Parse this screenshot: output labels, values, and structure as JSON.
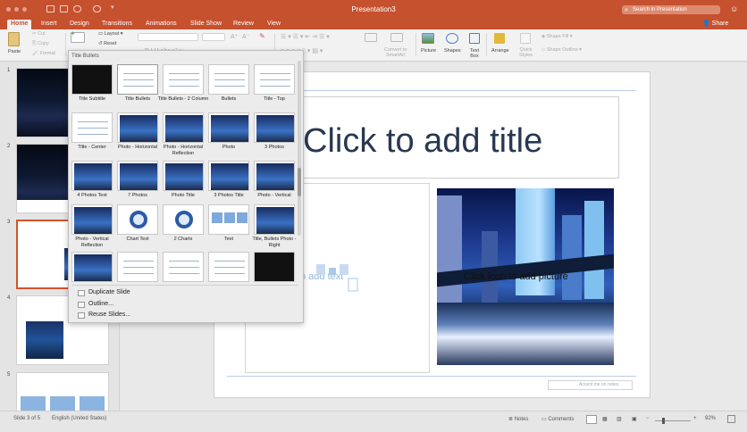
{
  "window": {
    "title": "Presentation3"
  },
  "search": {
    "placeholder": "Search in Presentation"
  },
  "share_label": "Share",
  "tabs": [
    "Home",
    "Insert",
    "Design",
    "Transitions",
    "Animations",
    "Slide Show",
    "Review",
    "View"
  ],
  "ribbon": {
    "paste": "Paste",
    "cut": "Cut",
    "copy": "Copy",
    "format": "Format",
    "layout": "Layout",
    "reset": "Reset",
    "convert_smartart": [
      "Convert to",
      "SmartArt"
    ],
    "picture": "Picture",
    "shapes": "Shapes",
    "text_box": [
      "Text",
      "Box"
    ],
    "arrange": "Arrange",
    "quick_styles": [
      "Quick",
      "Styles"
    ],
    "shape_fill": "Shape Fill",
    "shape_outline": "Shape Outline"
  },
  "slide_numbers": [
    "1",
    "2",
    "3",
    "4",
    "5"
  ],
  "slide": {
    "title_placeholder": "Click to add title",
    "content_placeholder": "o add text",
    "picture_placeholder": "Click icon to add picture",
    "footer_placeholder": "Accent me on notes"
  },
  "layout_gallery": {
    "header": "Title  Bullets",
    "layouts": [
      "Title Subtitle",
      "Title  Bullets",
      "Title  Bullets - 2 Column",
      "Bullets",
      "Title - Top",
      "Title - Center",
      "Photo - Horizontal",
      "Photo - Horizontal Reflection",
      "Photo",
      "3 Photos",
      "4 Photos  Text",
      "7 Photos",
      "Photo  Title",
      "3 Photos  Title",
      "Photo - Vertical",
      "Photo - Vertical Reflection",
      "Chart  Text",
      "2 Charts",
      "Text",
      "Title, Bullets  Photo - Right",
      "",
      "",
      "",
      "",
      ""
    ],
    "menu": [
      "Duplicate Slide",
      "Outline...",
      "Reuse Slides..."
    ]
  },
  "status": {
    "slide_count": "Slide 3 of 5",
    "language": "English (United States)",
    "notes": "Notes",
    "comments": "Comments",
    "zoom": "92%"
  },
  "colors": {
    "accent": "#c6512f",
    "selection": "#d0542c"
  }
}
